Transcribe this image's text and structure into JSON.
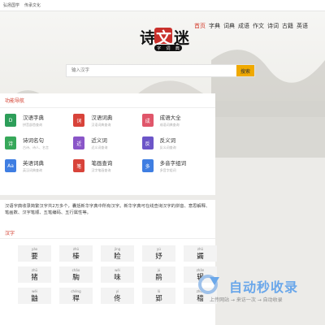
{
  "topbar": {
    "links": [
      "弘扬国学",
      "传承文化"
    ]
  },
  "logo": {
    "chars": [
      "诗",
      "文",
      "迷"
    ],
    "pill": [
      "字",
      "词",
      "典"
    ]
  },
  "nav": [
    "首页",
    "字典",
    "词典",
    "成语",
    "作文",
    "诗词",
    "古籍",
    "英语"
  ],
  "search": {
    "placeholder": "输入汉字",
    "button": "搜索"
  },
  "func": {
    "title": "功能导航",
    "items": [
      {
        "name": "汉语字典",
        "desc": "拼音部首查询",
        "icon": "D",
        "color": "#2d9e59"
      },
      {
        "name": "汉语词典",
        "desc": "汉语词典查询",
        "icon": "词",
        "color": "#d8433a"
      },
      {
        "name": "成语大全",
        "desc": "成语词典查询",
        "icon": "成",
        "color": "#e0566a"
      },
      {
        "name": "诗词名句",
        "desc": "古诗、诗人、名言",
        "icon": "诗",
        "color": "#37a85a"
      },
      {
        "name": "近义词",
        "desc": "近义词查询",
        "icon": "近",
        "color": "#8a56c8"
      },
      {
        "name": "反义词",
        "desc": "反义词查询",
        "icon": "反",
        "color": "#6c55c8"
      },
      {
        "name": "英语词典",
        "desc": "英汉词典查询",
        "icon": "Aa",
        "color": "#3f7ee2"
      },
      {
        "name": "笔画查询",
        "desc": "汉字笔画查询",
        "icon": "笔",
        "color": "#d8433a"
      },
      {
        "name": "多音字组词",
        "desc": "多音字组词",
        "icon": "多",
        "color": "#3f7ee2"
      }
    ]
  },
  "intro": {
    "text": "汉语字典收录简繁汉字共2万多个，囊括新华字典中所有汉字。新华字典可在线查询汉字的拼音、意思解释、笔画数、汉字笔顺、五笔编码、五行属性等。"
  },
  "chars": {
    "title": "汉字",
    "rows": [
      [
        {
          "py": "yào",
          "hz": "要"
        },
        {
          "py": "zhǔ",
          "hz": "榛"
        },
        {
          "py": "jìng",
          "hz": "睑"
        },
        {
          "py": "yú",
          "hz": "妤"
        },
        {
          "py": "zhǔ",
          "hz": "蠲"
        }
      ],
      [
        {
          "py": "zhū",
          "hz": "猪"
        },
        {
          "py": "chǎo",
          "hz": "騊"
        },
        {
          "py": "wèi",
          "hz": "味"
        },
        {
          "py": "jú",
          "hz": "鹃"
        },
        {
          "py": "zhǎn",
          "hz": "辗"
        }
      ],
      [
        {
          "py": "wéi",
          "hz": "鼬"
        },
        {
          "py": "chéng",
          "hz": "稈"
        },
        {
          "py": "yì",
          "hz": "佟"
        },
        {
          "py": "lǔ",
          "hz": "郢"
        },
        {
          "py": "zhǒu",
          "hz": "穑"
        }
      ]
    ]
  },
  "watermark": {
    "title": "自动秒收录",
    "sub": "上传网站 → 来访一次 → 自动收录"
  }
}
